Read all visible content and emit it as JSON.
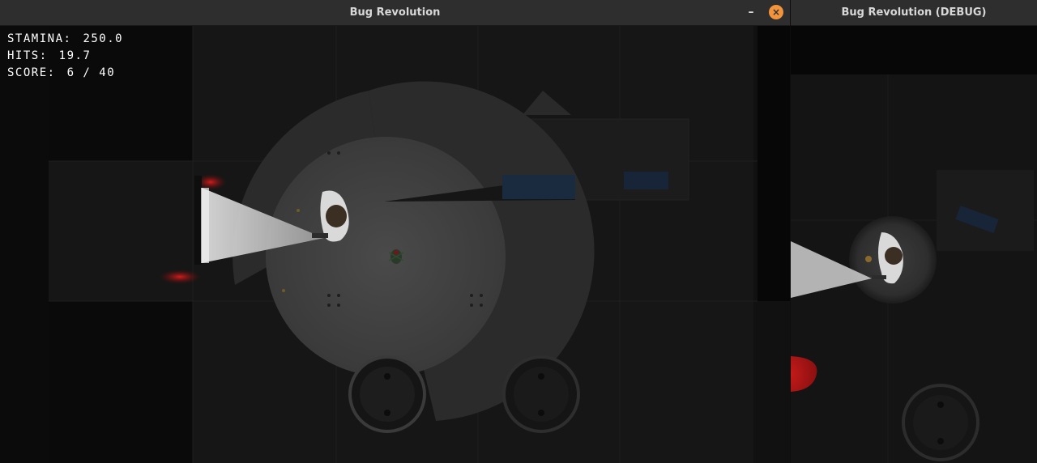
{
  "main_window": {
    "title": "Bug Revolution",
    "minimize_glyph": "–",
    "close_glyph": "×"
  },
  "debug_window": {
    "title": "Bug Revolution (DEBUG)"
  },
  "hud": {
    "stamina_label": "Stamina:",
    "stamina_value": "250.0",
    "hits_label": "Hits:",
    "hits_value": "19.7",
    "score_label": "Score:",
    "score_value": "6 / 40"
  },
  "colors": {
    "titlebar": "#2e2e2e",
    "close_button": "#f1943c",
    "floor": "#141414",
    "alarm_red": "#c41a1a"
  },
  "icons": {
    "minimize": "minimize-icon",
    "close": "close-icon"
  }
}
